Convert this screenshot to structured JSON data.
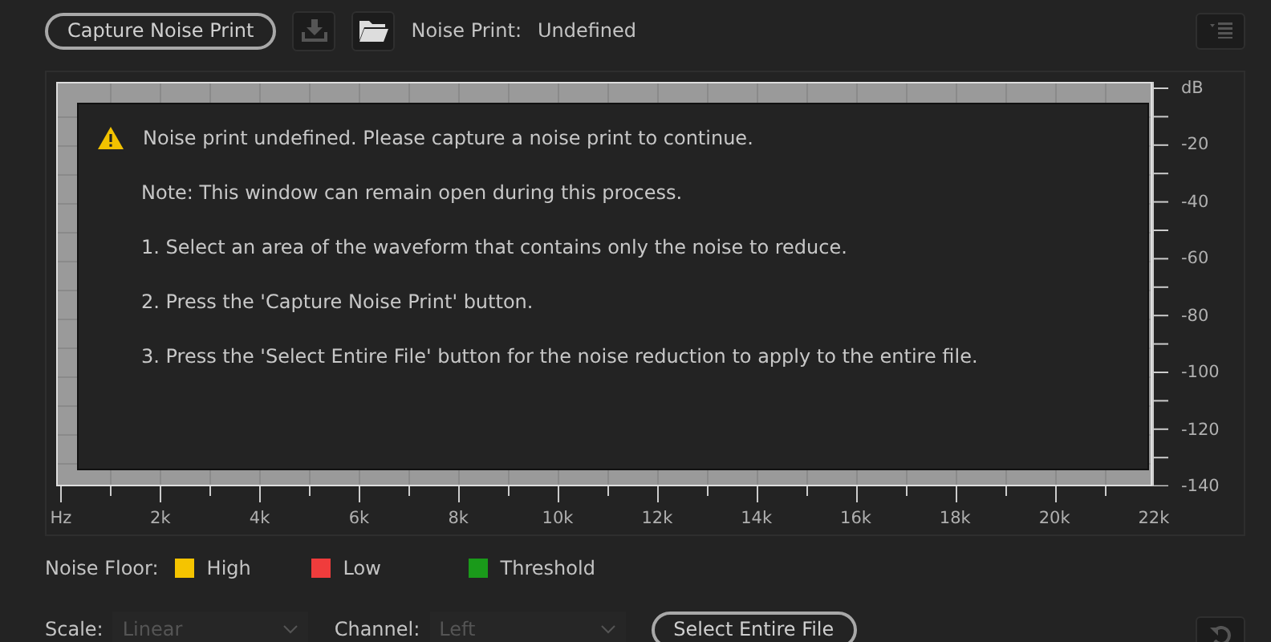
{
  "toolbar": {
    "capture_button": "Capture Noise Print",
    "save_button": {
      "disabled": true
    },
    "open_button": {
      "disabled": false
    },
    "noise_print_label": "Noise Print:",
    "noise_print_value": "Undefined"
  },
  "chart": {
    "y_labels": [
      "dB",
      "-20",
      "-40",
      "-60",
      "-80",
      "-100",
      "-120",
      "-140"
    ],
    "x_labels": [
      "Hz",
      "2k",
      "4k",
      "6k",
      "8k",
      "10k",
      "12k",
      "14k",
      "16k",
      "18k",
      "20k",
      "22k"
    ]
  },
  "message": {
    "title": "Noise print undefined. Please capture a noise print to continue.",
    "lines": [
      "Note: This window can remain open during this process.",
      "1. Select an area of the waveform that contains only the noise to reduce.",
      "2. Press the 'Capture Noise Print' button.",
      "3. Press the 'Select Entire File' button for the noise reduction to apply to the entire file."
    ]
  },
  "legend": {
    "label": "Noise Floor:",
    "items": [
      {
        "label": "High",
        "color": "#f5c400"
      },
      {
        "label": "Low",
        "color": "#f03c3c"
      },
      {
        "label": "Threshold",
        "color": "#1a9a1a"
      }
    ]
  },
  "controls": {
    "scale_label": "Scale:",
    "scale": {
      "value": "Linear",
      "disabled": true
    },
    "channel_label": "Channel:",
    "channel": {
      "value": "Left",
      "disabled": true
    },
    "select_button": "Select Entire File"
  }
}
